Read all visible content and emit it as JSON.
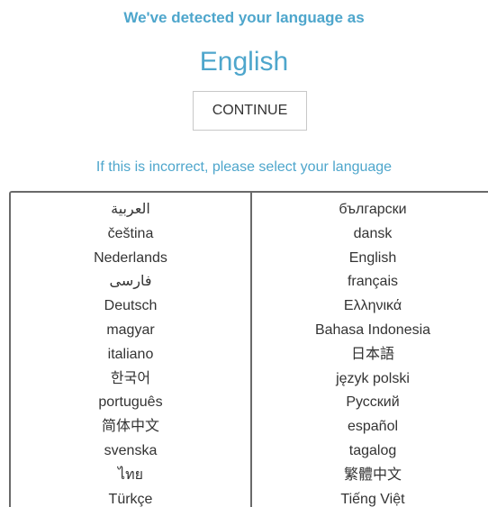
{
  "detected": {
    "heading": "We've detected your language as",
    "language": "English",
    "continue_label": "CONTINUE"
  },
  "selector": {
    "prompt": "If this is incorrect, please select your language",
    "left_column": [
      "العربية",
      "čeština",
      "Nederlands",
      "فارسی",
      "Deutsch",
      "magyar",
      "italiano",
      "한국어",
      "português",
      "简体中文",
      "svenska",
      "ไทย",
      "Türkçe"
    ],
    "right_column": [
      "български",
      "dansk",
      "English",
      "français",
      "Ελληνικά",
      "Bahasa Indonesia",
      "日本語",
      "język polski",
      "Русский",
      "español",
      "tagalog",
      "繁體中文",
      "Tiếng Việt"
    ]
  },
  "colors": {
    "accent": "#4ea6cc",
    "text": "#333333",
    "border": "#6a6a6a"
  }
}
